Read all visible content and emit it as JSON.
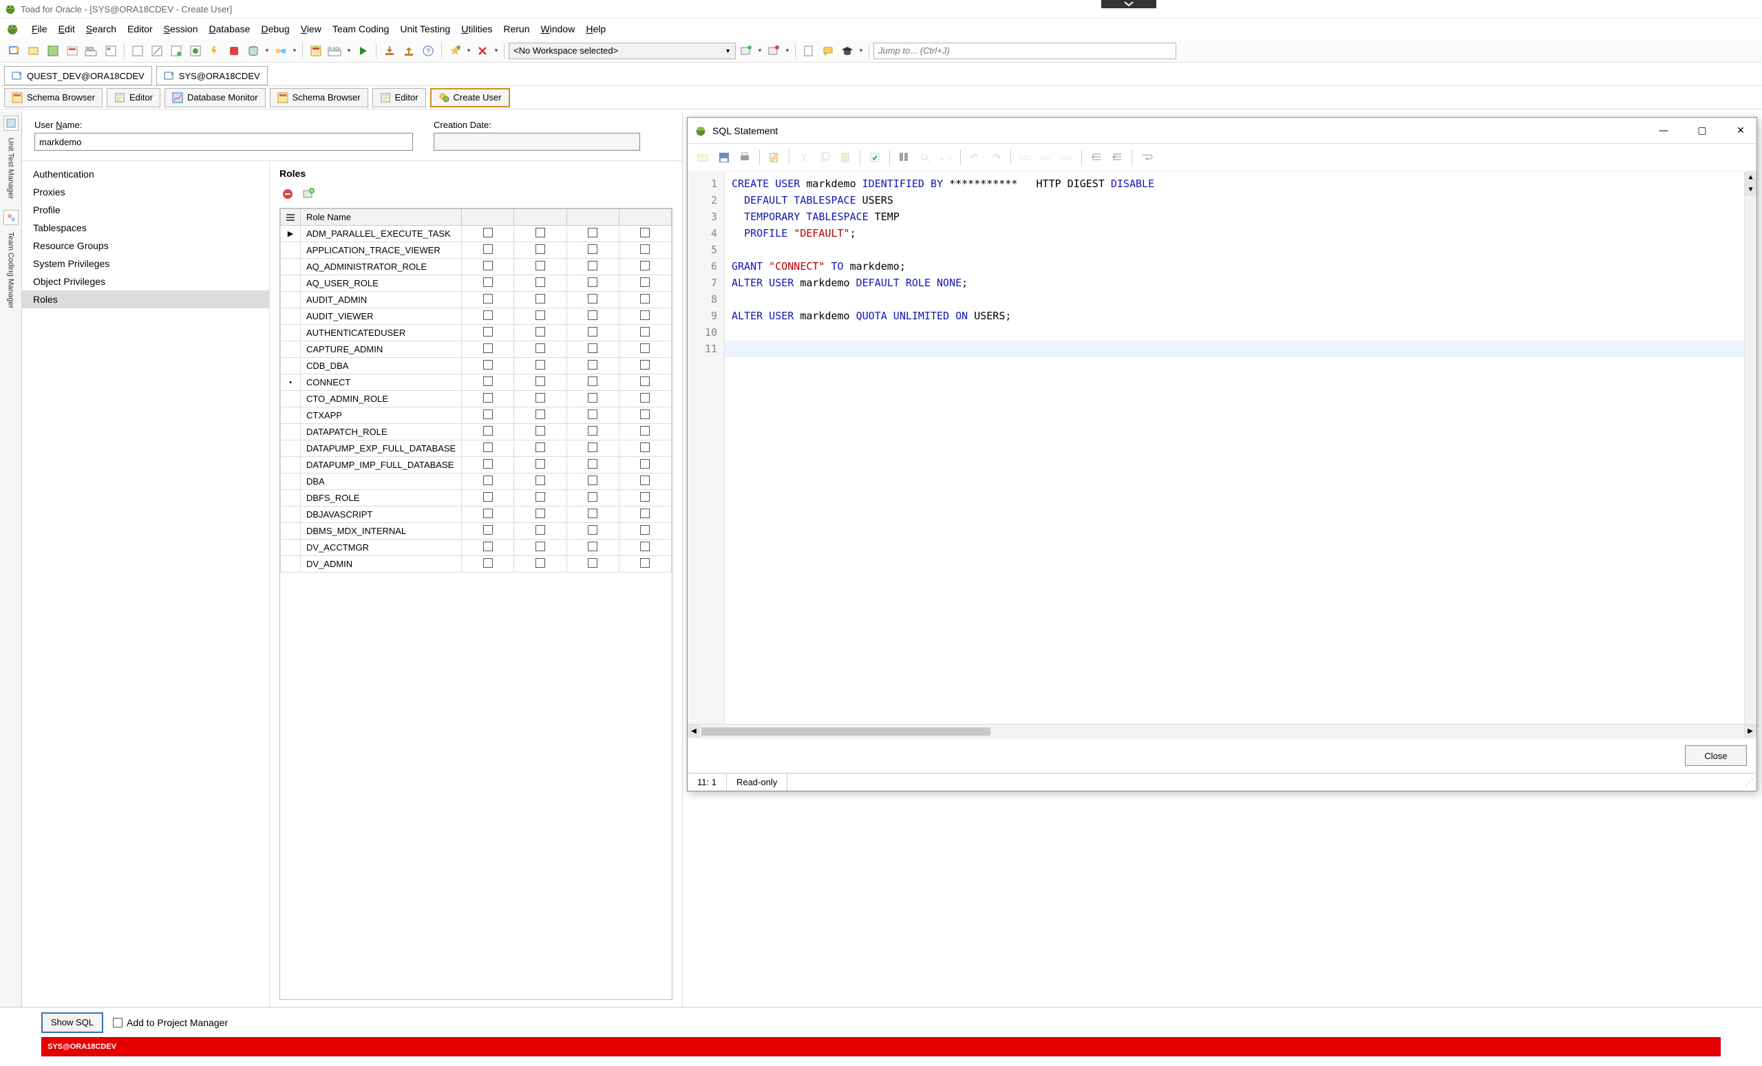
{
  "window": {
    "title": "Toad for Oracle - [SYS@ORA18CDEV - Create User]"
  },
  "menu": [
    "File",
    "Edit",
    "Search",
    "Editor",
    "Session",
    "Database",
    "Debug",
    "View",
    "Team Coding",
    "Unit Testing",
    "Utilities",
    "Rerun",
    "Window",
    "Help"
  ],
  "menu_u": [
    "F",
    "E",
    "S",
    "",
    "S",
    "D",
    "D",
    "V",
    "",
    "",
    "U",
    "",
    "W",
    "H"
  ],
  "workspace": {
    "text": "<No Workspace selected>"
  },
  "jump": {
    "placeholder": "Jump to... (Ctrl+J)"
  },
  "conn_tabs": [
    {
      "label": "QUEST_DEV@ORA18CDEV"
    },
    {
      "label": "SYS@ORA18CDEV"
    }
  ],
  "doc_tabs": [
    {
      "label": "Schema Browser"
    },
    {
      "label": "Editor"
    },
    {
      "label": "Database Monitor"
    },
    {
      "label": "Schema Browser"
    },
    {
      "label": "Editor"
    },
    {
      "label": "Create User",
      "active": true
    }
  ],
  "spine": [
    {
      "label": "Unit Test Manager"
    },
    {
      "label": "Team Coding Manager"
    }
  ],
  "create_user": {
    "username_label": "User Name:",
    "username_value": "markdemo",
    "creation_label": "Creation Date:",
    "creation_value": "",
    "nav": [
      "Authentication",
      "Proxies",
      "Profile",
      "Tablespaces",
      "Resource Groups",
      "System Privileges",
      "Object Privileges",
      "Roles"
    ],
    "nav_selected": "Roles",
    "section_title": "Roles",
    "columns": [
      "Role Name"
    ],
    "roles": [
      {
        "name": "ADM_PARALLEL_EXECUTE_TASK",
        "mark": "▶"
      },
      {
        "name": "APPLICATION_TRACE_VIEWER"
      },
      {
        "name": "AQ_ADMINISTRATOR_ROLE"
      },
      {
        "name": "AQ_USER_ROLE"
      },
      {
        "name": "AUDIT_ADMIN"
      },
      {
        "name": "AUDIT_VIEWER"
      },
      {
        "name": "AUTHENTICATEDUSER"
      },
      {
        "name": "CAPTURE_ADMIN"
      },
      {
        "name": "CDB_DBA"
      },
      {
        "name": "CONNECT",
        "mark": "•"
      },
      {
        "name": "CTO_ADMIN_ROLE"
      },
      {
        "name": "CTXAPP"
      },
      {
        "name": "DATAPATCH_ROLE"
      },
      {
        "name": "DATAPUMP_EXP_FULL_DATABASE"
      },
      {
        "name": "DATAPUMP_IMP_FULL_DATABASE"
      },
      {
        "name": "DBA"
      },
      {
        "name": "DBFS_ROLE"
      },
      {
        "name": "DBJAVASCRIPT"
      },
      {
        "name": "DBMS_MDX_INTERNAL"
      },
      {
        "name": "DV_ACCTMGR"
      },
      {
        "name": "DV_ADMIN"
      }
    ],
    "extra_check_cols": 4
  },
  "sql_dialog": {
    "title": "SQL Statement",
    "close_label": "Close",
    "lines": [
      [
        [
          "kw",
          "CREATE USER"
        ],
        [
          "id",
          " markdemo "
        ],
        [
          "kw",
          "IDENTIFIED BY"
        ],
        [
          "id",
          " *********** "
        ],
        [
          "id",
          "  HTTP DIGEST "
        ],
        [
          "kw",
          "DISABLE"
        ]
      ],
      [
        [
          "id",
          "  "
        ],
        [
          "kw",
          "DEFAULT TABLESPACE"
        ],
        [
          "id",
          " USERS"
        ]
      ],
      [
        [
          "id",
          "  "
        ],
        [
          "kw",
          "TEMPORARY TABLESPACE"
        ],
        [
          "id",
          " TEMP"
        ]
      ],
      [
        [
          "id",
          "  "
        ],
        [
          "kw",
          "PROFILE"
        ],
        [
          "id",
          " "
        ],
        [
          "str",
          "\"DEFAULT\""
        ],
        [
          "id",
          ";"
        ]
      ],
      [],
      [
        [
          "kw",
          "GRANT"
        ],
        [
          "id",
          " "
        ],
        [
          "str",
          "\"CONNECT\""
        ],
        [
          "id",
          " "
        ],
        [
          "kw",
          "TO"
        ],
        [
          "id",
          " markdemo;"
        ]
      ],
      [
        [
          "kw",
          "ALTER USER"
        ],
        [
          "id",
          " markdemo "
        ],
        [
          "kw",
          "DEFAULT ROLE NONE"
        ],
        [
          "id",
          ";"
        ]
      ],
      [],
      [
        [
          "kw",
          "ALTER USER"
        ],
        [
          "id",
          " markdemo "
        ],
        [
          "kw",
          "QUOTA UNLIMITED ON"
        ],
        [
          "id",
          " USERS;"
        ]
      ],
      [],
      []
    ],
    "status": {
      "pos": "11:  1",
      "mode": "Read-only"
    }
  },
  "bottom": {
    "show_sql": "Show SQL",
    "add_project": "Add to Project Manager",
    "status_conn": "SYS@ORA18CDEV"
  }
}
